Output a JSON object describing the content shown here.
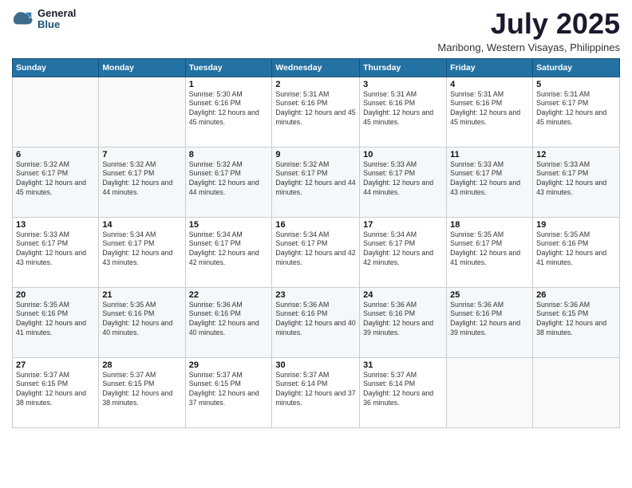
{
  "logo": {
    "general": "General",
    "blue": "Blue"
  },
  "header": {
    "month": "July 2025",
    "location": "Maribong, Western Visayas, Philippines"
  },
  "weekdays": [
    "Sunday",
    "Monday",
    "Tuesday",
    "Wednesday",
    "Thursday",
    "Friday",
    "Saturday"
  ],
  "weeks": [
    [
      {
        "day": "",
        "info": ""
      },
      {
        "day": "",
        "info": ""
      },
      {
        "day": "1",
        "info": "Sunrise: 5:30 AM\nSunset: 6:16 PM\nDaylight: 12 hours and 45 minutes."
      },
      {
        "day": "2",
        "info": "Sunrise: 5:31 AM\nSunset: 6:16 PM\nDaylight: 12 hours and 45 minutes."
      },
      {
        "day": "3",
        "info": "Sunrise: 5:31 AM\nSunset: 6:16 PM\nDaylight: 12 hours and 45 minutes."
      },
      {
        "day": "4",
        "info": "Sunrise: 5:31 AM\nSunset: 6:16 PM\nDaylight: 12 hours and 45 minutes."
      },
      {
        "day": "5",
        "info": "Sunrise: 5:31 AM\nSunset: 6:17 PM\nDaylight: 12 hours and 45 minutes."
      }
    ],
    [
      {
        "day": "6",
        "info": "Sunrise: 5:32 AM\nSunset: 6:17 PM\nDaylight: 12 hours and 45 minutes."
      },
      {
        "day": "7",
        "info": "Sunrise: 5:32 AM\nSunset: 6:17 PM\nDaylight: 12 hours and 44 minutes."
      },
      {
        "day": "8",
        "info": "Sunrise: 5:32 AM\nSunset: 6:17 PM\nDaylight: 12 hours and 44 minutes."
      },
      {
        "day": "9",
        "info": "Sunrise: 5:32 AM\nSunset: 6:17 PM\nDaylight: 12 hours and 44 minutes."
      },
      {
        "day": "10",
        "info": "Sunrise: 5:33 AM\nSunset: 6:17 PM\nDaylight: 12 hours and 44 minutes."
      },
      {
        "day": "11",
        "info": "Sunrise: 5:33 AM\nSunset: 6:17 PM\nDaylight: 12 hours and 43 minutes."
      },
      {
        "day": "12",
        "info": "Sunrise: 5:33 AM\nSunset: 6:17 PM\nDaylight: 12 hours and 43 minutes."
      }
    ],
    [
      {
        "day": "13",
        "info": "Sunrise: 5:33 AM\nSunset: 6:17 PM\nDaylight: 12 hours and 43 minutes."
      },
      {
        "day": "14",
        "info": "Sunrise: 5:34 AM\nSunset: 6:17 PM\nDaylight: 12 hours and 43 minutes."
      },
      {
        "day": "15",
        "info": "Sunrise: 5:34 AM\nSunset: 6:17 PM\nDaylight: 12 hours and 42 minutes."
      },
      {
        "day": "16",
        "info": "Sunrise: 5:34 AM\nSunset: 6:17 PM\nDaylight: 12 hours and 42 minutes."
      },
      {
        "day": "17",
        "info": "Sunrise: 5:34 AM\nSunset: 6:17 PM\nDaylight: 12 hours and 42 minutes."
      },
      {
        "day": "18",
        "info": "Sunrise: 5:35 AM\nSunset: 6:17 PM\nDaylight: 12 hours and 41 minutes."
      },
      {
        "day": "19",
        "info": "Sunrise: 5:35 AM\nSunset: 6:16 PM\nDaylight: 12 hours and 41 minutes."
      }
    ],
    [
      {
        "day": "20",
        "info": "Sunrise: 5:35 AM\nSunset: 6:16 PM\nDaylight: 12 hours and 41 minutes."
      },
      {
        "day": "21",
        "info": "Sunrise: 5:35 AM\nSunset: 6:16 PM\nDaylight: 12 hours and 40 minutes."
      },
      {
        "day": "22",
        "info": "Sunrise: 5:36 AM\nSunset: 6:16 PM\nDaylight: 12 hours and 40 minutes."
      },
      {
        "day": "23",
        "info": "Sunrise: 5:36 AM\nSunset: 6:16 PM\nDaylight: 12 hours and 40 minutes."
      },
      {
        "day": "24",
        "info": "Sunrise: 5:36 AM\nSunset: 6:16 PM\nDaylight: 12 hours and 39 minutes."
      },
      {
        "day": "25",
        "info": "Sunrise: 5:36 AM\nSunset: 6:16 PM\nDaylight: 12 hours and 39 minutes."
      },
      {
        "day": "26",
        "info": "Sunrise: 5:36 AM\nSunset: 6:15 PM\nDaylight: 12 hours and 38 minutes."
      }
    ],
    [
      {
        "day": "27",
        "info": "Sunrise: 5:37 AM\nSunset: 6:15 PM\nDaylight: 12 hours and 38 minutes."
      },
      {
        "day": "28",
        "info": "Sunrise: 5:37 AM\nSunset: 6:15 PM\nDaylight: 12 hours and 38 minutes."
      },
      {
        "day": "29",
        "info": "Sunrise: 5:37 AM\nSunset: 6:15 PM\nDaylight: 12 hours and 37 minutes."
      },
      {
        "day": "30",
        "info": "Sunrise: 5:37 AM\nSunset: 6:14 PM\nDaylight: 12 hours and 37 minutes."
      },
      {
        "day": "31",
        "info": "Sunrise: 5:37 AM\nSunset: 6:14 PM\nDaylight: 12 hours and 36 minutes."
      },
      {
        "day": "",
        "info": ""
      },
      {
        "day": "",
        "info": ""
      }
    ]
  ]
}
